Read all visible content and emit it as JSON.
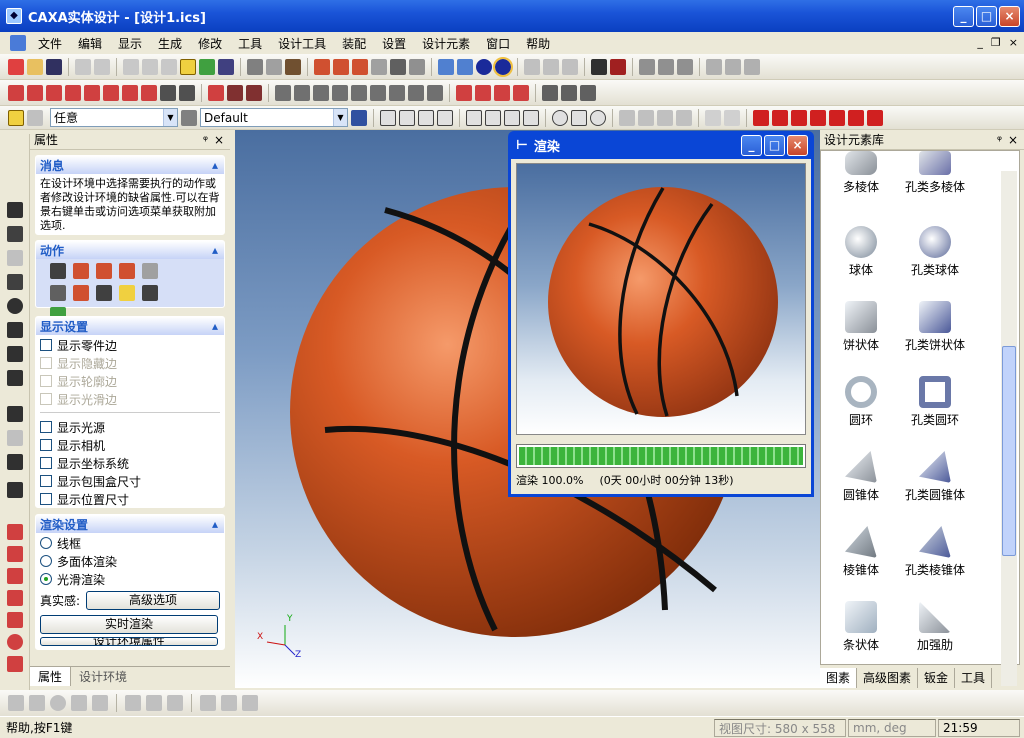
{
  "window": {
    "title": "CAXA实体设计 - [设计1.ics]",
    "app_icon": "CAXA-icon"
  },
  "menu": [
    "文件",
    "编辑",
    "显示",
    "生成",
    "修改",
    "工具",
    "设计工具",
    "装配",
    "设置",
    "设计元素",
    "窗口",
    "帮助"
  ],
  "toolbar": {
    "combo_select": "任意",
    "combo_style": "Default"
  },
  "props": {
    "header": "属性",
    "msg_title": "消息",
    "msg_text": "在设计环境中选择需要执行的动作或者修改设计环境的缺省属性.可以在背景右键单击或访问选项菜单获取附加选项.",
    "action_title": "动作",
    "display_title": "显示设置",
    "display_items": [
      "显示零件边",
      "显示隐藏边",
      "显示轮廓边",
      "显示光滑边",
      "显示光源",
      "显示相机",
      "显示坐标系统",
      "显示包围盒尺寸",
      "显示位置尺寸"
    ],
    "render_title": "渲染设置",
    "render_options": [
      "线框",
      "多面体渲染",
      "光滑渲染"
    ],
    "realism_label": "真实感:",
    "advanced_btn": "高级选项",
    "realtime_btn": "实时渲染",
    "cutoff_btn": "设计环境属性",
    "tabs": [
      "属性",
      "设计环境"
    ]
  },
  "render_window": {
    "title": "渲染",
    "progress_label": "渲染 100.0%",
    "progress_value": 1.0,
    "time_text": "(0天 00小时 00分钟 13秒)"
  },
  "library": {
    "header": "设计元素库",
    "items": [
      "多棱体",
      "孔类多棱体",
      "球体",
      "孔类球体",
      "饼状体",
      "孔类饼状体",
      "圆环",
      "孔类圆环",
      "圆锥体",
      "孔类圆锥体",
      "棱锥体",
      "孔类棱锥体",
      "条状体",
      "加强肋"
    ],
    "tabs": [
      "图素",
      "高级图素",
      "钣金",
      "工具"
    ]
  },
  "axes": {
    "x": "X",
    "y": "Y",
    "z": "Z"
  },
  "status": {
    "help": "帮助,按F1键",
    "viewsize": "视图尺寸: 580 x 558",
    "units": "mm, deg",
    "clock": "21:59"
  },
  "colors": {
    "title_blue": "#0a46d6",
    "ball_orange": "#c8501f",
    "progress_green": "#3cb43c"
  }
}
